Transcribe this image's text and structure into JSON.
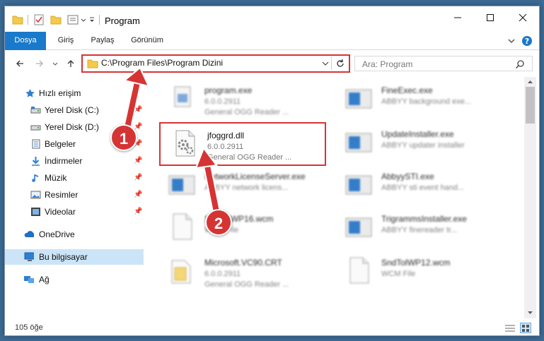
{
  "window": {
    "title": "Program"
  },
  "ribbon": {
    "tabs": [
      "Dosya",
      "Giriş",
      "Paylaş",
      "Görünüm"
    ]
  },
  "address": {
    "path": "C:\\Program Files\\Program Dizini",
    "search_placeholder": "Ara: Program"
  },
  "sidebar": {
    "items": [
      {
        "label": "Hızlı erişim",
        "icon": "star-icon"
      },
      {
        "label": "Yerel Disk (C:)",
        "icon": "drive-icon"
      },
      {
        "label": "Yerel Disk (D:)",
        "icon": "drive-icon"
      },
      {
        "label": "Belgeler",
        "icon": "documents-icon"
      },
      {
        "label": "İndirmeler",
        "icon": "downloads-icon"
      },
      {
        "label": "Müzik",
        "icon": "music-icon"
      },
      {
        "label": "Resimler",
        "icon": "pictures-icon"
      },
      {
        "label": "Videolar",
        "icon": "videos-icon"
      },
      {
        "label": "OneDrive",
        "icon": "cloud-icon"
      },
      {
        "label": "Bu bilgisayar",
        "icon": "computer-icon"
      },
      {
        "label": "Ağ",
        "icon": "network-icon"
      }
    ]
  },
  "files": [
    {
      "name": "program.exe",
      "line2": "6.0.0.2911",
      "line3": "General OGG Reader ...",
      "icon": "exe-icon"
    },
    {
      "name": "FineExec.exe",
      "line2": "ABBYY background exe...",
      "line3": "",
      "icon": "app-window-icon"
    },
    {
      "name": "jfoggrd.dll",
      "line2": "6.0.0.2911",
      "line3": "General OGG Reader ...",
      "icon": "dll-gear-icon"
    },
    {
      "name": "UpdateInstaller.exe",
      "line2": "ABBYY updater installer",
      "line3": "",
      "icon": "app-window-icon"
    },
    {
      "name": "NetworkLicenseServer.exe",
      "line2": "ABBYY network licens...",
      "line3": "",
      "icon": "app-window-icon"
    },
    {
      "name": "AbbyySTI.exe",
      "line2": "ABBYY sti event hand...",
      "line3": "",
      "icon": "app-window-icon"
    },
    {
      "name": "SndTolWP16.wcm",
      "line2": "WCM File",
      "line3": "",
      "icon": "blank-file-icon"
    },
    {
      "name": "TrigrammsInstaller.exe",
      "line2": "ABBYY finereader tr...",
      "line3": "",
      "icon": "app-window-icon"
    },
    {
      "name": "Microsoft.VC90.CRT",
      "line2": "6.0.0.2911",
      "line3": "General OGG Reader ...",
      "icon": "folder-doc-icon"
    },
    {
      "name": "SndTolWP12.wcm",
      "line2": "WCM File",
      "line3": "",
      "icon": "blank-file-icon"
    }
  ],
  "status": {
    "item_count": "105 öğe"
  },
  "annotations": {
    "step1": "1",
    "step2": "2",
    "color": "#d63434"
  }
}
